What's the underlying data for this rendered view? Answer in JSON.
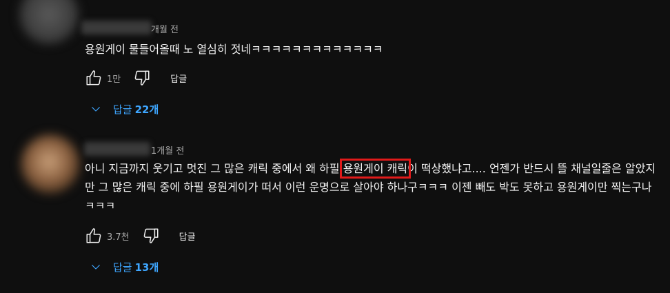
{
  "comments": [
    {
      "timestamp": "개월 전",
      "text": "용원게이 물들어올때 노 열심히 젓네ㅋㅋㅋㅋㅋㅋㅋㅋㅋㅋㅋㅋㅋ",
      "likes": "1만",
      "reply_label": "답글",
      "replies_word": "답글",
      "replies_count": "22개"
    },
    {
      "timestamp": "1개월 전",
      "text_before": "아니 지금까지 웃기고 멋진 그 많은 캐릭 중에서 왜 하필 ",
      "text_highlight": "용원게이 캐릭",
      "text_after": "이 떡상했냐고.... 언젠가 반드시 뜰 채널일줄은 알았지만 그 많은 캐릭 중에 하필 용원게이가 떠서 이런 운명으로 살아야 하나구ㅋㅋㅋ 이젠 빼도 박도 못하고 용원게이만 찍는구나 ㅋㅋㅋ",
      "likes": "3.7천",
      "reply_label": "답글",
      "replies_word": "답글",
      "replies_count": "13개"
    }
  ],
  "colors": {
    "background": "#0f0f0f",
    "text": "#f1f1f1",
    "secondary_text": "#aaaaaa",
    "link_blue": "#3ea6ff",
    "highlight_box": "#e11a1a"
  },
  "icons": {
    "like": "thumbs-up-icon",
    "dislike": "thumbs-down-icon",
    "expand": "chevron-down-icon"
  }
}
